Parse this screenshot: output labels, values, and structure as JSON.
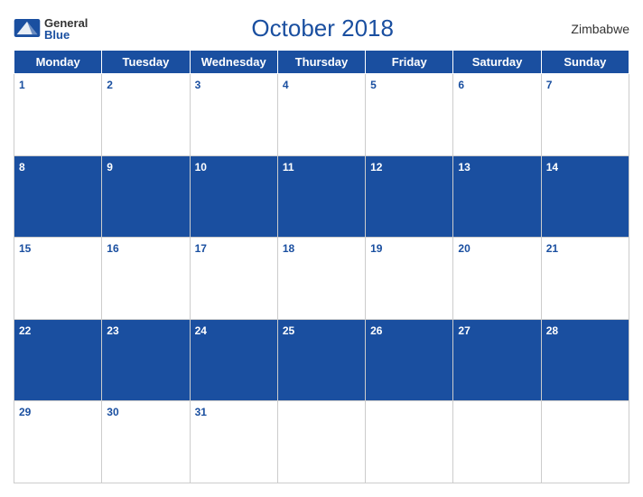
{
  "header": {
    "logo_general": "General",
    "logo_blue": "Blue",
    "title": "October 2018",
    "country": "Zimbabwe"
  },
  "weekdays": [
    "Monday",
    "Tuesday",
    "Wednesday",
    "Thursday",
    "Friday",
    "Saturday",
    "Sunday"
  ],
  "weeks": [
    {
      "row_style": "white",
      "days": [
        {
          "num": "1",
          "style": "white"
        },
        {
          "num": "2",
          "style": "white"
        },
        {
          "num": "3",
          "style": "white"
        },
        {
          "num": "4",
          "style": "white"
        },
        {
          "num": "5",
          "style": "white"
        },
        {
          "num": "6",
          "style": "white"
        },
        {
          "num": "7",
          "style": "white"
        }
      ]
    },
    {
      "row_style": "blue",
      "days": [
        {
          "num": "8",
          "style": "blue"
        },
        {
          "num": "9",
          "style": "blue"
        },
        {
          "num": "10",
          "style": "blue"
        },
        {
          "num": "11",
          "style": "blue"
        },
        {
          "num": "12",
          "style": "blue"
        },
        {
          "num": "13",
          "style": "blue"
        },
        {
          "num": "14",
          "style": "blue"
        }
      ]
    },
    {
      "row_style": "white",
      "days": [
        {
          "num": "15",
          "style": "white"
        },
        {
          "num": "16",
          "style": "white"
        },
        {
          "num": "17",
          "style": "white"
        },
        {
          "num": "18",
          "style": "white"
        },
        {
          "num": "19",
          "style": "white"
        },
        {
          "num": "20",
          "style": "white"
        },
        {
          "num": "21",
          "style": "white"
        }
      ]
    },
    {
      "row_style": "blue",
      "days": [
        {
          "num": "22",
          "style": "blue"
        },
        {
          "num": "23",
          "style": "blue"
        },
        {
          "num": "24",
          "style": "blue"
        },
        {
          "num": "25",
          "style": "blue"
        },
        {
          "num": "26",
          "style": "blue"
        },
        {
          "num": "27",
          "style": "blue"
        },
        {
          "num": "28",
          "style": "blue"
        }
      ]
    },
    {
      "row_style": "white",
      "days": [
        {
          "num": "29",
          "style": "white"
        },
        {
          "num": "30",
          "style": "white"
        },
        {
          "num": "31",
          "style": "white"
        },
        {
          "num": "",
          "style": "white"
        },
        {
          "num": "",
          "style": "white"
        },
        {
          "num": "",
          "style": "white"
        },
        {
          "num": "",
          "style": "white"
        }
      ]
    }
  ]
}
